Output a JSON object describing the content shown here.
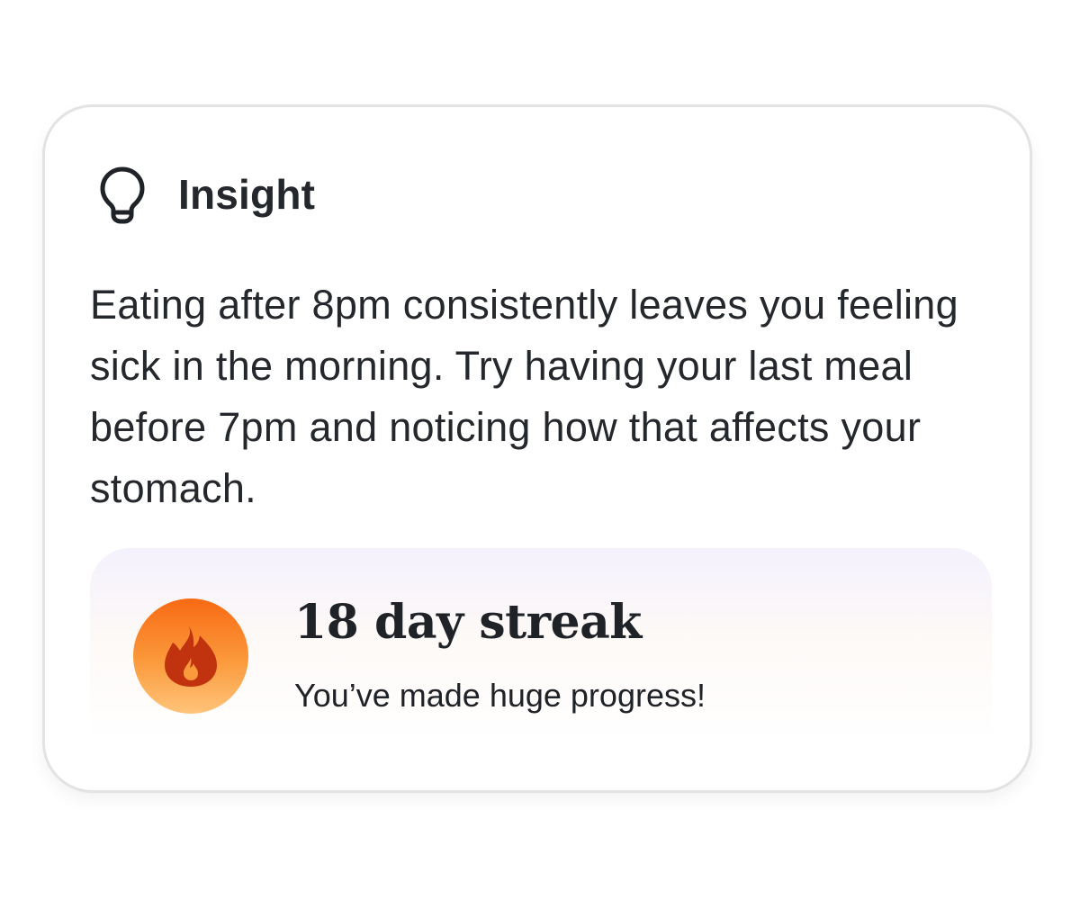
{
  "insight": {
    "icon": "lightbulb-icon",
    "title": "Insight",
    "text": "Eating after 8pm consistently leaves you feeling sick in the morning. Try having your last meal before 7pm and noticing how that affects your stomach."
  },
  "streak": {
    "icon": "flame-icon",
    "title": "18 day streak",
    "subtitle": "You’ve made huge progress!",
    "badge_colors": [
      "#f86a14",
      "#ffc47a"
    ],
    "flame_color": "#c0330e"
  }
}
